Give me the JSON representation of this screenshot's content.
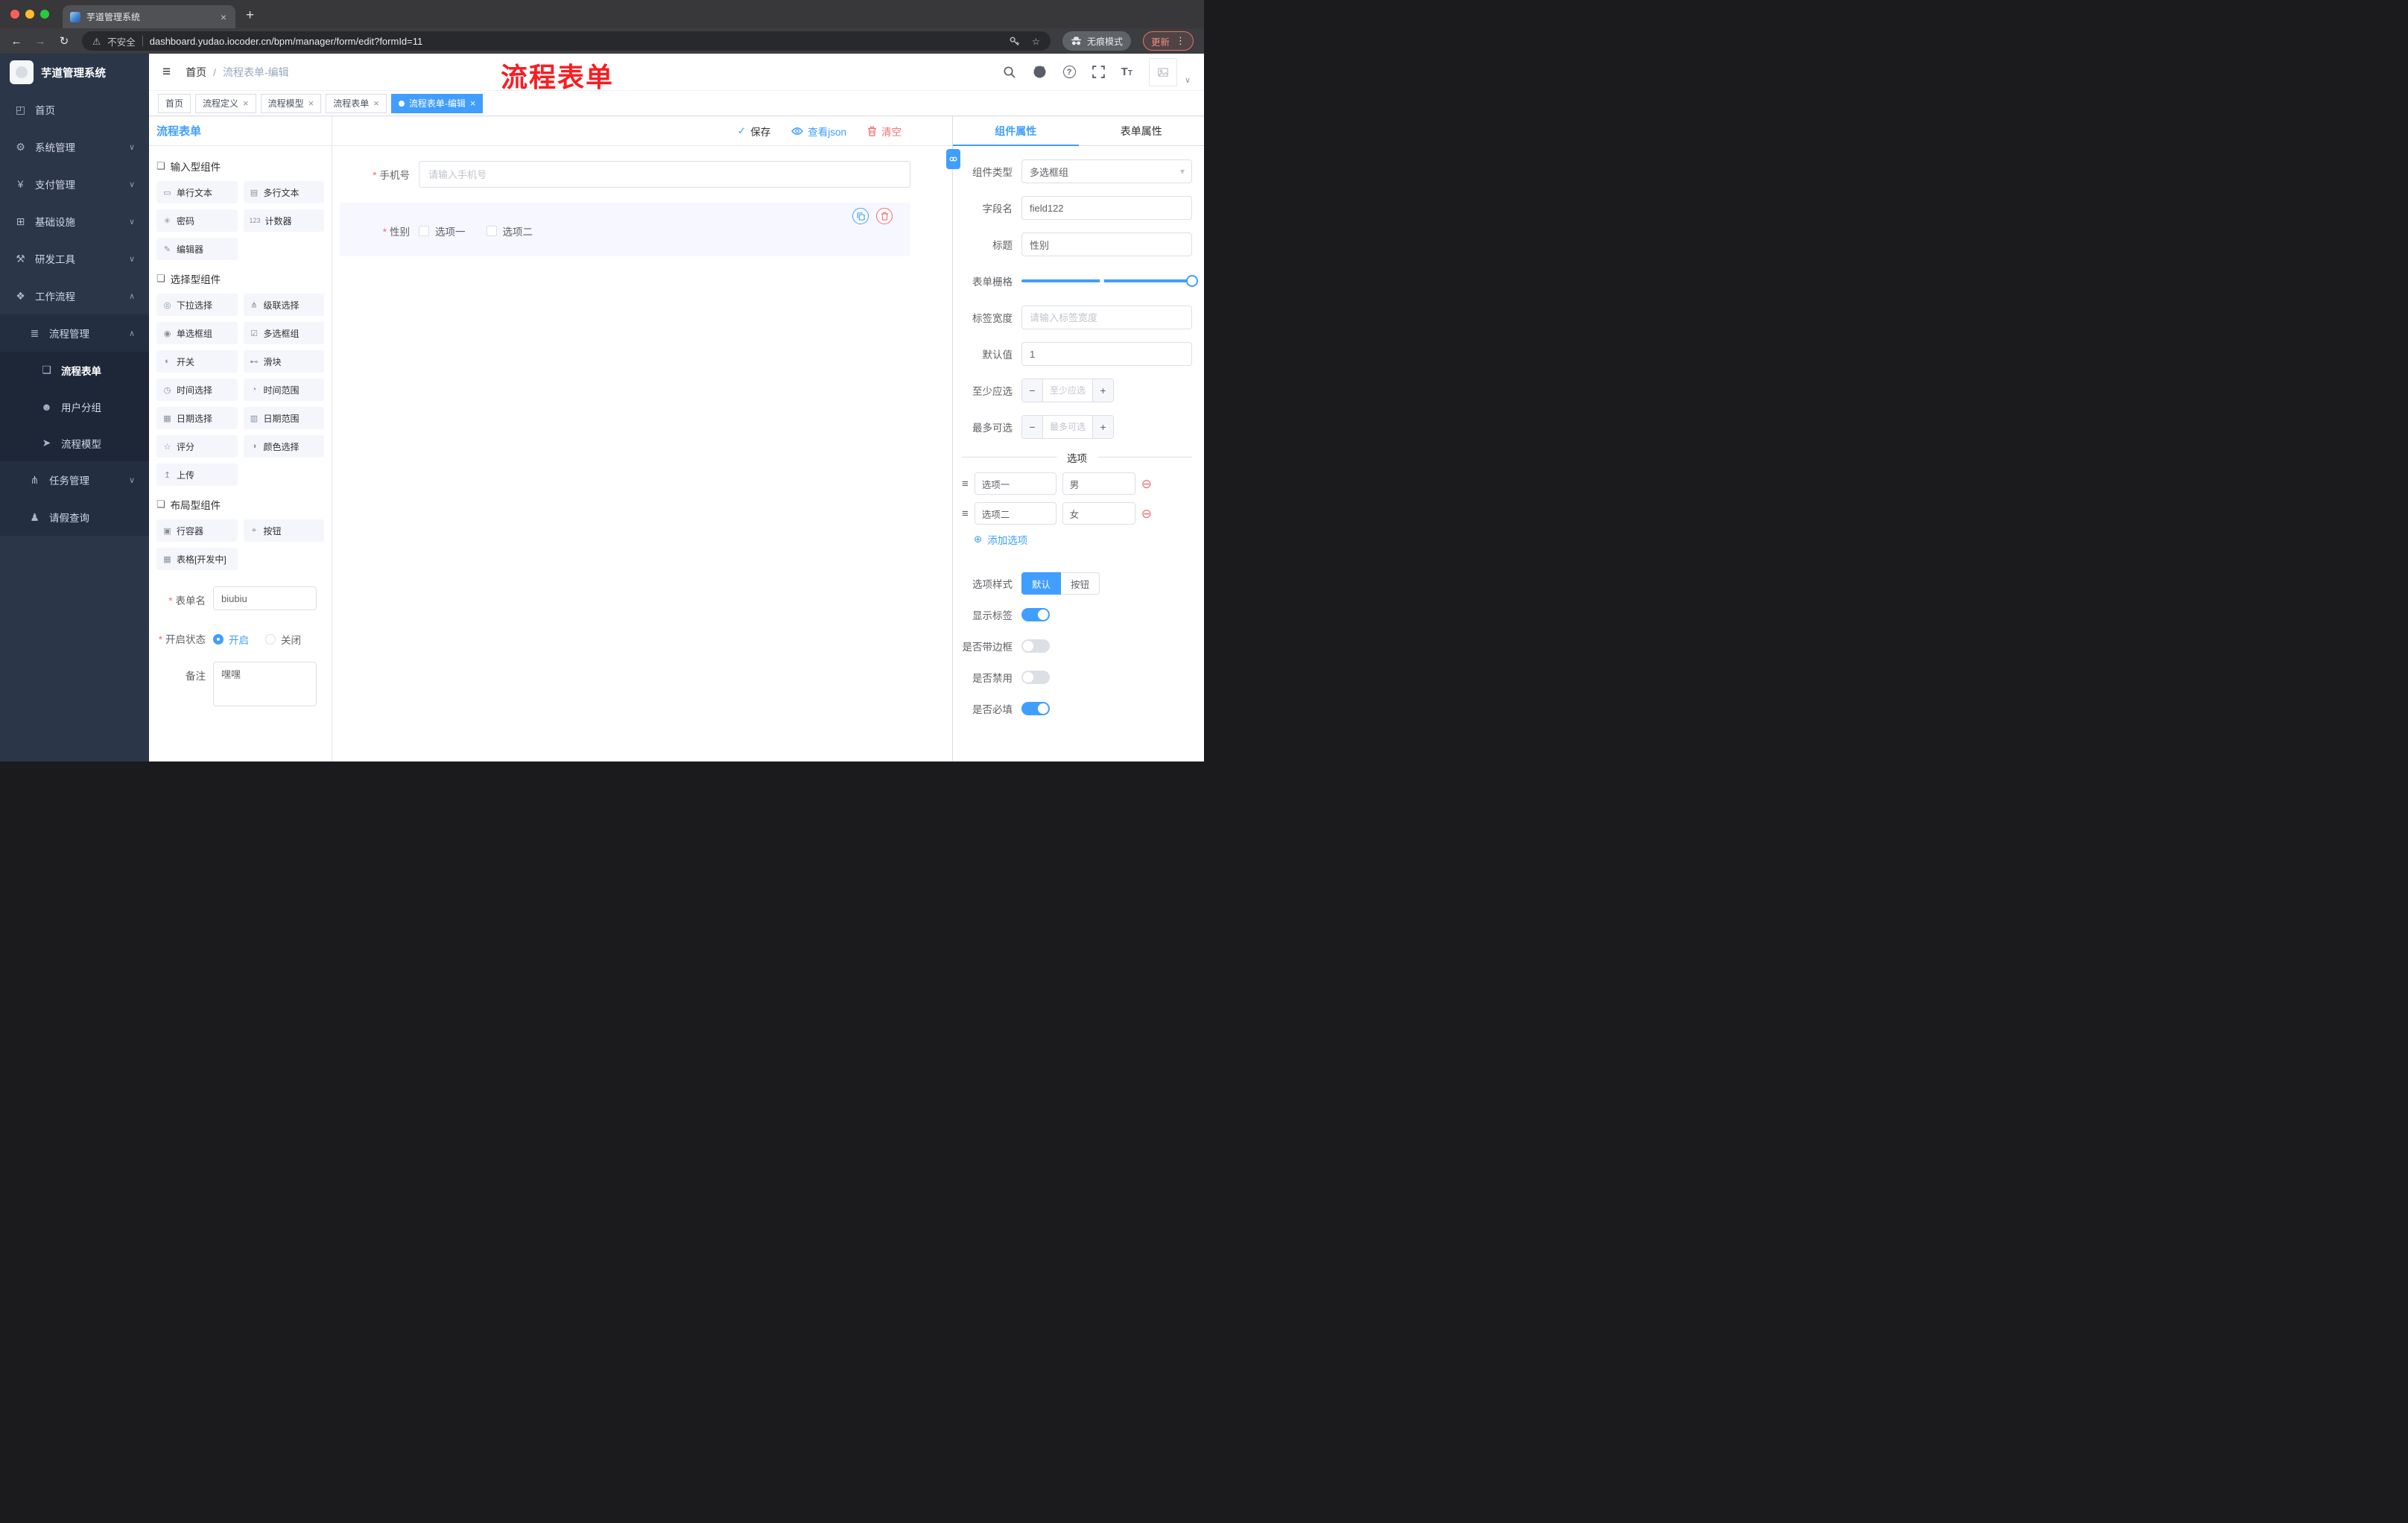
{
  "browser": {
    "tab": {
      "title": "芋道管理系统"
    },
    "nav": {
      "security_label": "不安全",
      "url": "dashboard.yudao.iocoder.cn/bpm/manager/form/edit?formId=11",
      "incognito_label": "无痕模式",
      "update_label": "更新"
    }
  },
  "sidebar": {
    "logo_title": "芋道管理系统",
    "items": [
      {
        "label": "首页",
        "glyph": "◰"
      },
      {
        "label": "系统管理",
        "glyph": "⚙"
      },
      {
        "label": "支付管理",
        "glyph": "¥"
      },
      {
        "label": "基础设施",
        "glyph": "⊞"
      },
      {
        "label": "研发工具",
        "glyph": "⚒"
      },
      {
        "label": "工作流程",
        "glyph": "❖"
      },
      {
        "label": "流程管理",
        "glyph": "≣"
      },
      {
        "label": "流程表单",
        "glyph": "❏"
      },
      {
        "label": "用户分组",
        "glyph": "☻"
      },
      {
        "label": "流程模型",
        "glyph": "➤"
      },
      {
        "label": "任务管理",
        "glyph": "⋔"
      },
      {
        "label": "请假查询",
        "glyph": "♟"
      }
    ]
  },
  "header": {
    "breadcrumb": {
      "home": "首页",
      "separator": "/",
      "current": "流程表单-编辑"
    },
    "annotation": {
      "text": "流程表单",
      "color": "#f81d22"
    }
  },
  "tags": [
    {
      "label": "首页"
    },
    {
      "label": "流程定义"
    },
    {
      "label": "流程模型"
    },
    {
      "label": "流程表单"
    },
    {
      "label": "流程表单-编辑"
    }
  ],
  "palette": {
    "title": "流程表单",
    "sections": [
      {
        "title": "输入型组件",
        "items": [
          {
            "label": "单行文本",
            "glyph": "▭"
          },
          {
            "label": "多行文本",
            "glyph": "▤"
          },
          {
            "label": "密码",
            "glyph": "✳"
          },
          {
            "label": "计数器",
            "glyph": "123"
          },
          {
            "label": "编辑器",
            "glyph": "✎"
          }
        ]
      },
      {
        "title": "选择型组件",
        "items": [
          {
            "label": "下拉选择",
            "glyph": "◎"
          },
          {
            "label": "级联选择",
            "glyph": "⋔"
          },
          {
            "label": "单选框组",
            "glyph": "◉"
          },
          {
            "label": "多选框组",
            "glyph": "☑"
          },
          {
            "label": "开关",
            "glyph": "◐"
          },
          {
            "label": "滑块",
            "glyph": "⊷"
          },
          {
            "label": "时间选择",
            "glyph": "◷"
          },
          {
            "label": "时间范围",
            "glyph": "◔"
          },
          {
            "label": "日期选择",
            "glyph": "▦"
          },
          {
            "label": "日期范围",
            "glyph": "▥"
          },
          {
            "label": "评分",
            "glyph": "☆"
          },
          {
            "label": "颜色选择",
            "glyph": "◑"
          },
          {
            "label": "上传",
            "glyph": "↥"
          }
        ]
      },
      {
        "title": "布局型组件",
        "items": [
          {
            "label": "行容器",
            "glyph": "▣"
          },
          {
            "label": "按钮",
            "glyph": "⌖"
          },
          {
            "label": "表格[开发中]",
            "glyph": "▦"
          }
        ]
      }
    ],
    "form": {
      "name_label": "表单名",
      "name_value": "biubiu",
      "status_label": "开启状态",
      "status_on": "开启",
      "status_off": "关闭",
      "remark_label": "备注",
      "remark_value": "嘿嘿"
    }
  },
  "canvas": {
    "toolbar": {
      "save": "保存",
      "view_json": "查看json",
      "clear": "清空"
    },
    "phone": {
      "label": "手机号",
      "placeholder": "请输入手机号"
    },
    "gender": {
      "label": "性别",
      "option1": "选项一",
      "option2": "选项二"
    }
  },
  "props": {
    "tab_component": "组件属性",
    "tab_form": "表单属性",
    "component_type": {
      "label": "组件类型",
      "value": "多选框组"
    },
    "field_name": {
      "label": "字段名",
      "value": "field122"
    },
    "title": {
      "label": "标题",
      "value": "性别"
    },
    "grid": {
      "label": "表单栅格"
    },
    "label_width": {
      "label": "标签宽度",
      "placeholder": "请输入标签宽度"
    },
    "default_value": {
      "label": "默认值",
      "value": "1"
    },
    "min_select": {
      "label": "至少应选",
      "placeholder": "至少应选"
    },
    "max_select": {
      "label": "最多可选",
      "placeholder": "最多可选"
    },
    "options": {
      "divider": "选项",
      "rows": [
        {
          "name": "选项一",
          "value": "男"
        },
        {
          "name": "选项二",
          "value": "女"
        }
      ],
      "add_label": "添加选项"
    },
    "option_style": {
      "label": "选项样式",
      "default": "默认",
      "button": "按钮"
    },
    "switches": [
      {
        "label": "显示标签"
      },
      {
        "label": "是否带边框"
      },
      {
        "label": "是否禁用"
      },
      {
        "label": "是否必填"
      }
    ]
  },
  "icons": {
    "close": "×",
    "plus": "+",
    "minus": "−",
    "back": "←",
    "forward": "→",
    "reload": "↻",
    "star": "☆",
    "warning": "⚠",
    "caret_down": "∨",
    "caret_up": "∧",
    "select_caret": "▾",
    "remove_circle": "⊖",
    "add_circle": "⊕",
    "drag": "≡",
    "hamburger": "≡",
    "check": "✓",
    "menu_dots": "⋮",
    "question": "?",
    "font_large": "T",
    "font_small": "T"
  },
  "colors": {
    "primary": "#409eff",
    "danger": "#f56c6c",
    "annotation": "#f81d22"
  }
}
